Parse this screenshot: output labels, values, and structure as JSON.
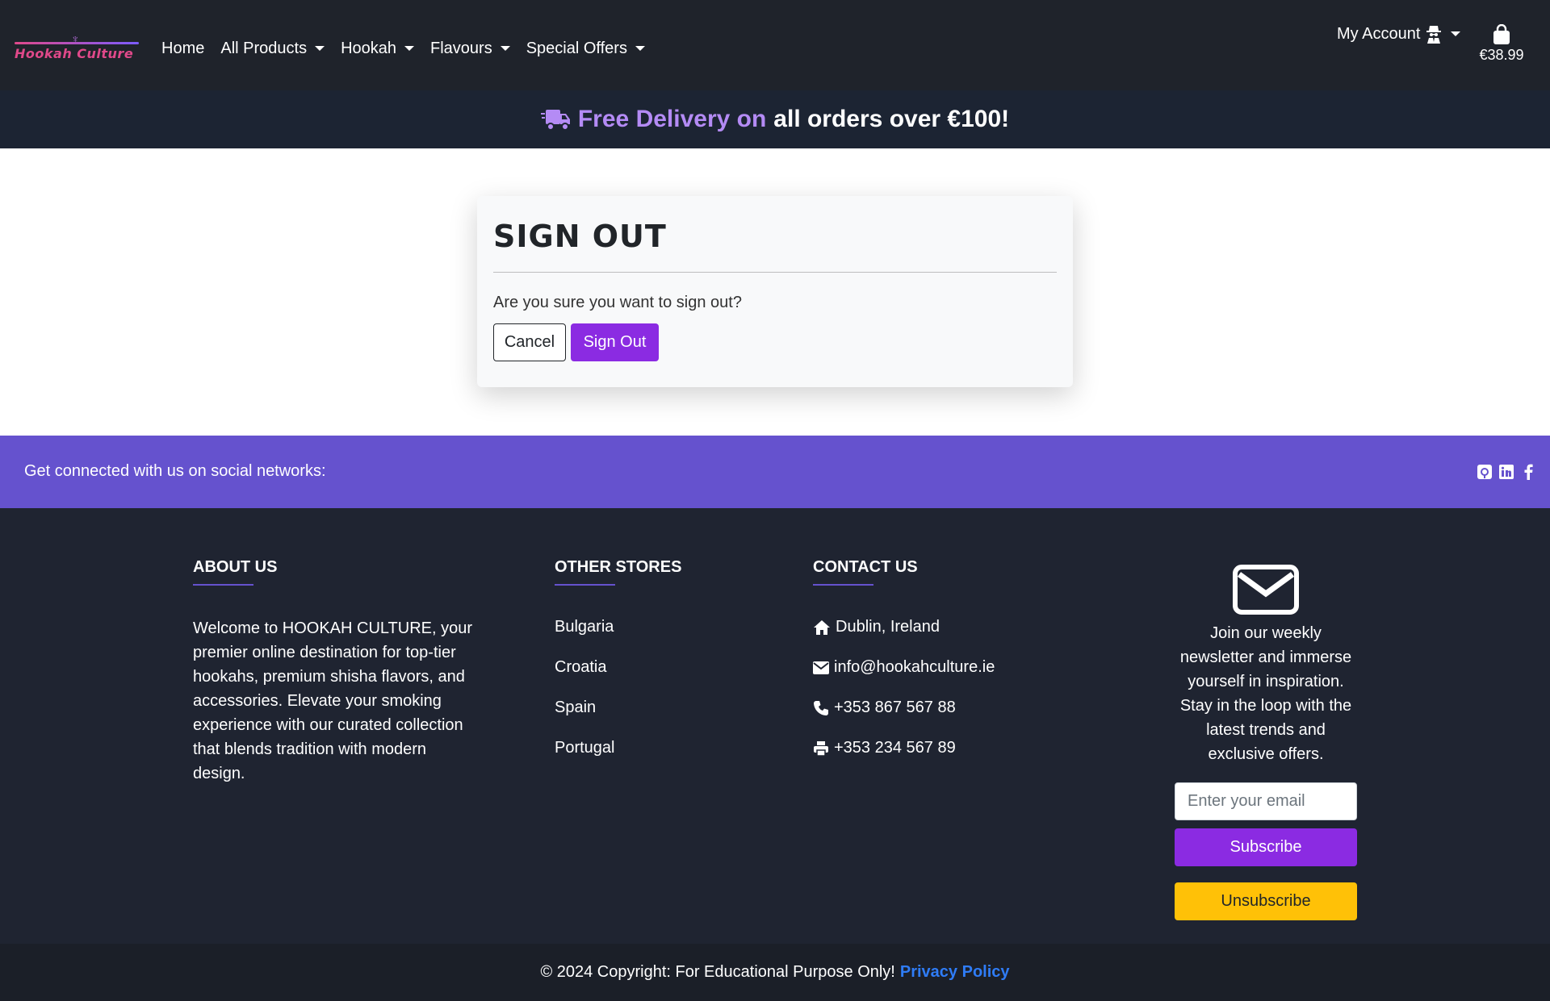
{
  "brand": {
    "logo_text": "Hookah Culture"
  },
  "nav": {
    "home": "Home",
    "all_products": "All Products",
    "hookah": "Hookah",
    "flavours": "Flavours",
    "special_offers": "Special Offers",
    "my_account": "My Account",
    "bag_total": "€38.99"
  },
  "banner": {
    "accent": "Free Delivery on",
    "rest": "all orders over €100!"
  },
  "signout_card": {
    "title": "SIGN OUT",
    "question": "Are you sure you want to sign out?",
    "cancel_label": "Cancel",
    "signout_label": "Sign Out"
  },
  "social": {
    "text": "Get connected with us on social networks:",
    "icons": [
      "github-icon",
      "linkedin-icon",
      "facebook-icon"
    ]
  },
  "footer": {
    "about": {
      "title": "ABOUT US",
      "text": "Welcome to HOOKAH CULTURE, your premier online destination for top-tier hookahs, premium shisha flavors, and accessories. Elevate your smoking experience with our curated collection that blends tradition with modern design."
    },
    "stores": {
      "title": "OTHER STORES",
      "items": [
        "Bulgaria",
        "Croatia",
        "Spain",
        "Portugal"
      ]
    },
    "contact": {
      "title": "CONTACT US",
      "address": "Dublin, Ireland",
      "email": "info@hookahculture.ie",
      "phone": "+353 867 567 88",
      "fax": "+353 234 567 89"
    },
    "newsletter": {
      "text": "Join our weekly newsletter and immerse yourself in inspiration. Stay in the loop with the latest trends and exclusive offers.",
      "placeholder": "Enter your email",
      "subscribe_label": "Subscribe",
      "unsubscribe_label": "Unsubscribe"
    },
    "copyright": "© 2024 Copyright: For Educational Purpose Only!",
    "privacy_label": "Privacy Policy"
  },
  "colors": {
    "navbar_bg": "#1f232b",
    "banner_bg": "#1c2433",
    "banner_accent": "#b48bf5",
    "primary_purple": "#8b2be2",
    "social_bar": "#6552ce",
    "footer_bg": "#1f2431",
    "warning_yellow": "#ffc107",
    "link_blue": "#2f7cf6"
  }
}
